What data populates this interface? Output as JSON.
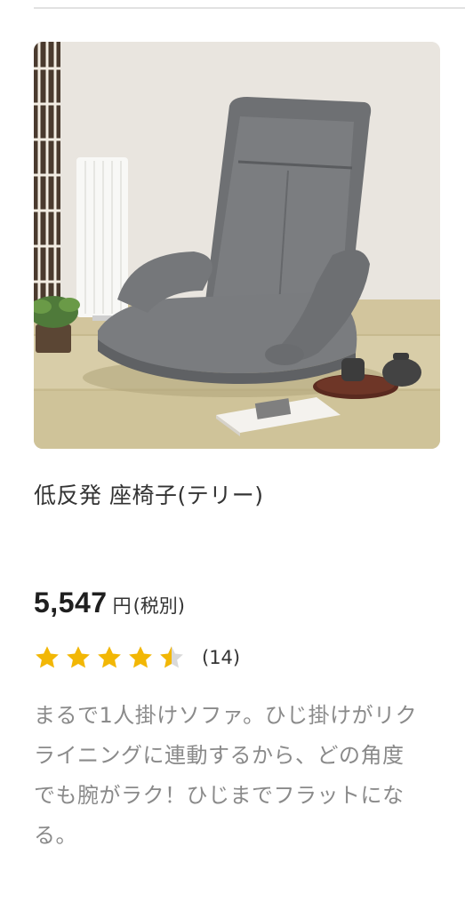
{
  "product": {
    "name": "低反発 座椅子(テリー)",
    "price": {
      "value": "5,547",
      "unit": "円",
      "tax_note": "(税別)"
    },
    "rating": {
      "stars_value": 4.5,
      "stars_max": 5,
      "review_count": "(14)",
      "star_color": "#f2b705",
      "empty_star_color": "#d9d9d9"
    },
    "description": "まるで1人掛けソファ。ひじ掛けがリクライニングに連動するから、どの角度でも腕がラク！ひじまでフラットになる。",
    "image": {
      "subject": "gray floor chair"
    }
  }
}
